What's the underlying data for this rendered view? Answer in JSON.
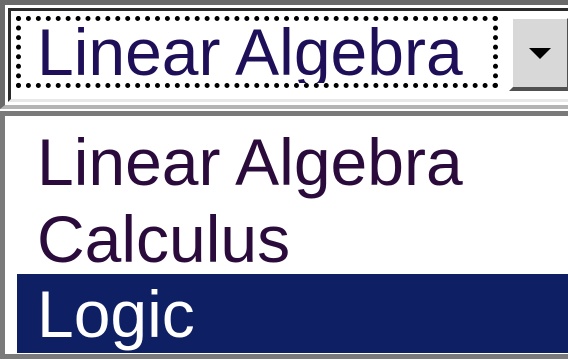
{
  "combobox": {
    "selected_value": "Linear Algebra",
    "dropdown_icon": "chevron-down-icon"
  },
  "dropdown": {
    "options": [
      {
        "label": "Linear Algebra",
        "highlighted": false
      },
      {
        "label": "Calculus",
        "highlighted": false
      },
      {
        "label": "Logic",
        "highlighted": true
      }
    ]
  },
  "colors": {
    "highlight_background": "#0f1f63",
    "highlight_text": "#ffffff",
    "text": "#1e0f58",
    "button_face": "#d8d8d8"
  }
}
